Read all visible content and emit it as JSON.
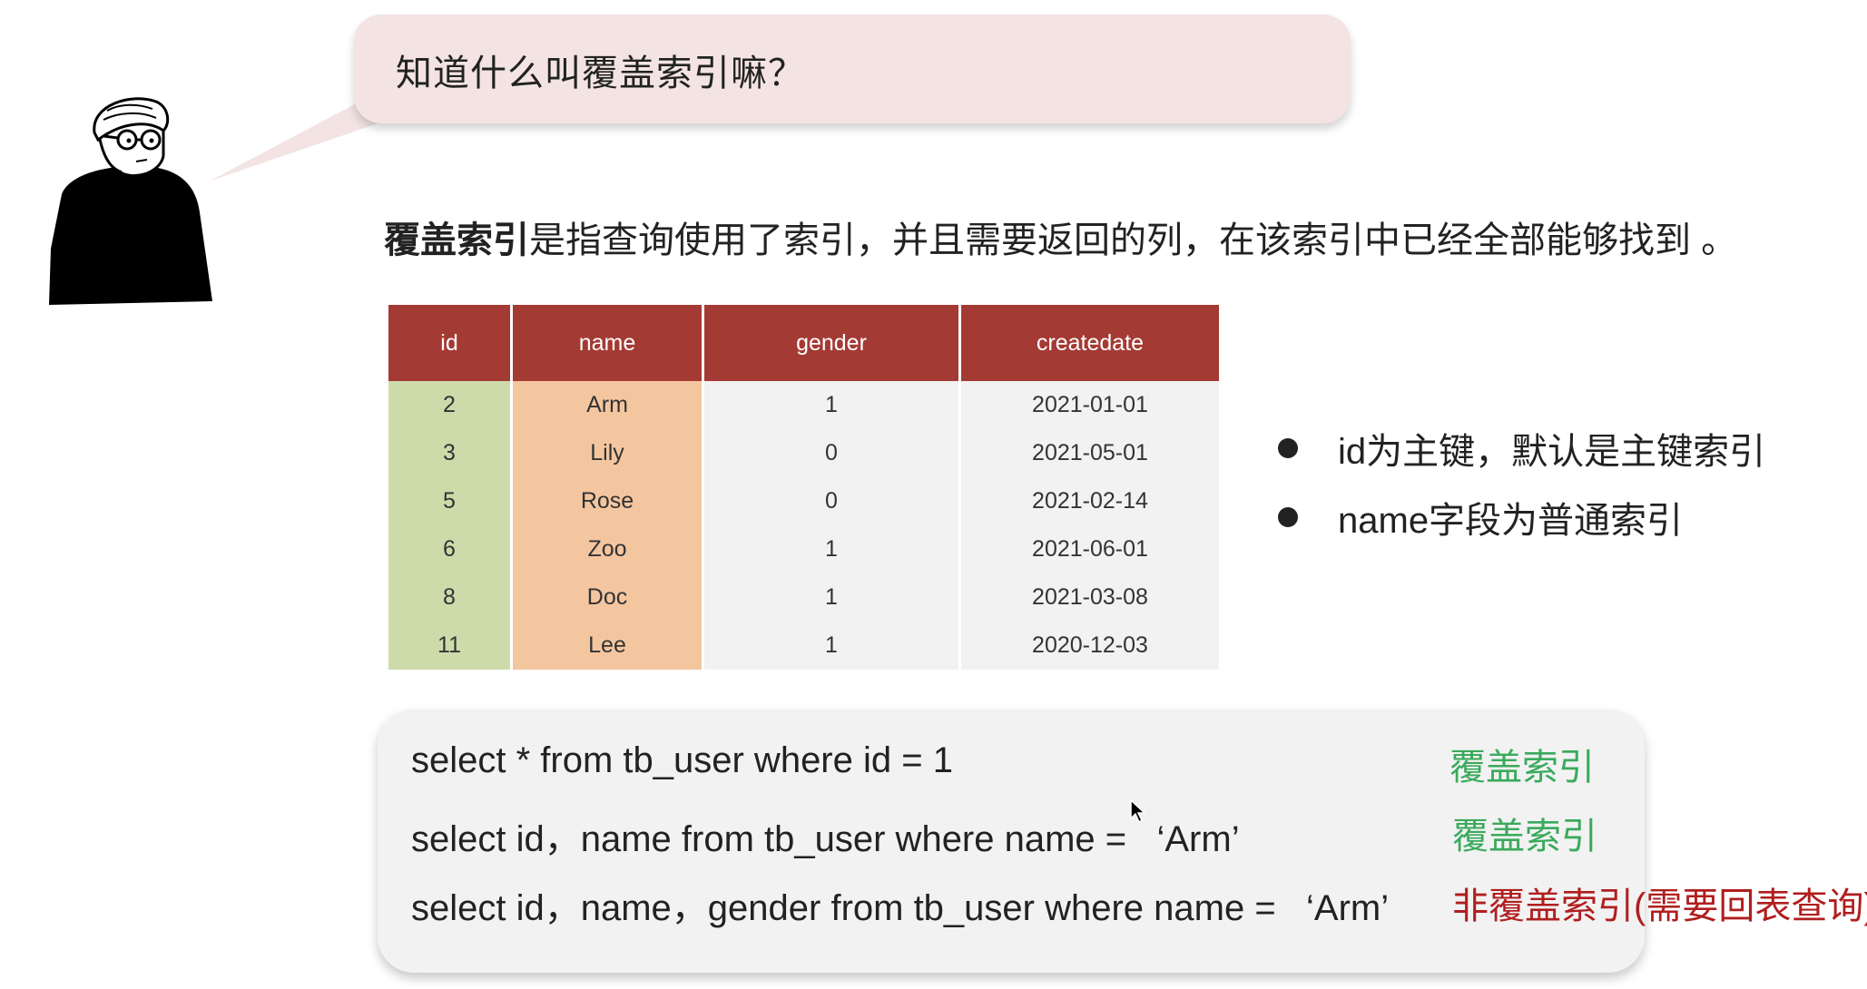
{
  "bubble": {
    "question": "知道什么叫覆盖索引嘛？"
  },
  "definition": {
    "term": "覆盖索引",
    "rest": "是指查询使用了索引，并且需要返回的列，在该索引中已经全部能够找到 。"
  },
  "table": {
    "headers": [
      "id",
      "name",
      "gender",
      "createdate"
    ],
    "rows": [
      [
        "2",
        "Arm",
        "1",
        "2021-01-01"
      ],
      [
        "3",
        "Lily",
        "0",
        "2021-05-01"
      ],
      [
        "5",
        "Rose",
        "0",
        "2021-02-14"
      ],
      [
        "6",
        "Zoo",
        "1",
        "2021-06-01"
      ],
      [
        "8",
        "Doc",
        "1",
        "2021-03-08"
      ],
      [
        "11",
        "Lee",
        "1",
        "2020-12-03"
      ]
    ]
  },
  "notes": [
    "id为主键，默认是主键索引",
    "name字段为普通索引"
  ],
  "queries": [
    {
      "sql": "select * from tb_user where id = 1",
      "tag": "覆盖索引",
      "tag_color": "#3aaa5c"
    },
    {
      "sql": "select id，name from tb_user where name =   ‘Arm’",
      "tag": "覆盖索引",
      "tag_color": "#3aaa5c"
    },
    {
      "sql": "select id，name，gender from tb_user where name =   ‘Arm’",
      "tag": "非覆盖索引(需要回表查询)",
      "tag_color": "#b01e1e"
    }
  ],
  "colors": {
    "header_bg": "#a43a34",
    "id_col_bg": "#cddbaa",
    "name_col_bg": "#f4c6a0",
    "cell_bg": "#f2f2f2",
    "bubble_bg": "#f3e4e3"
  }
}
